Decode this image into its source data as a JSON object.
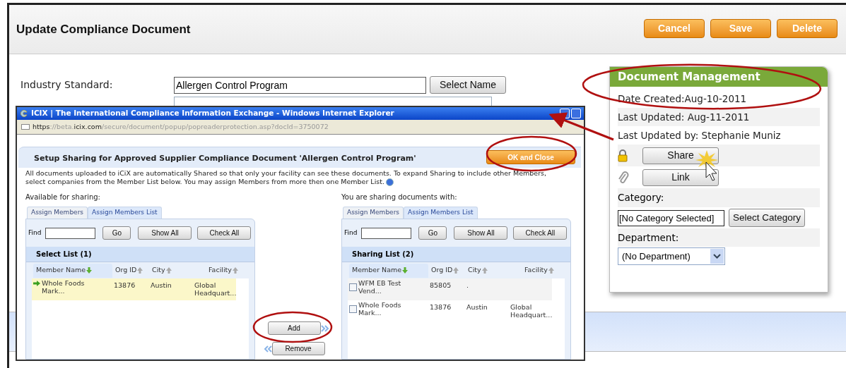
{
  "page": {
    "title": "Update Compliance Document",
    "buttons": [
      "Cancel",
      "Save",
      "Delete"
    ],
    "field": {
      "label": "Industry Standard:",
      "value": "Allergen Control Program",
      "button": "Select Name"
    }
  },
  "document_management": {
    "title": "Document Management",
    "info": [
      "Date Created:Aug-10-2011",
      "Last Updated: Aug-11-2011",
      "Last Updated by: Stephanie Muniz"
    ],
    "actions": [
      {
        "kind": "lock",
        "label": "Share"
      },
      {
        "kind": "clip",
        "label": "Link"
      }
    ],
    "category_label": "Category:",
    "category_value": "[No Category Selected]",
    "category_button": "Select Category",
    "department_label": "Department:",
    "department_value": "(No Department)"
  },
  "popup": {
    "window_title": "ICIX | The International Compliance Information Exchange - Windows Internet Explorer",
    "address": "**https**://beta.**icix.com**/secure/document/popup/popreaderprotection.asp?docId=3750072",
    "heading": "Setup Sharing for Approved Supplier Compliance Document 'Allergen Control Program'",
    "ok_button": "OK and Close",
    "description": "All documents uploaded to iCiX are automatically Shared so that only your facility can see these documents. To expand Sharing to include other Members, select companies from the Member List below. You may assign Members from more then one Member List.",
    "lists": [
      {
        "caption": "Available for sharing:",
        "tabs": [
          {
            "label": "Assign Members",
            "selected": false
          },
          {
            "label": "Assign Members List",
            "selected": true
          }
        ],
        "find_label": "Find",
        "buttons": [
          "Go",
          "Show All",
          "Check All"
        ],
        "title": "Select List (1)",
        "columns": [
          {
            "label": "Member Name",
            "sorted": true
          },
          {
            "label": "Org ID",
            "sorted": false
          },
          {
            "label": "City",
            "sorted": false
          },
          {
            "label": "Facility",
            "sorted": false
          }
        ],
        "rows": [
          {
            "kind": "arrow",
            "selected": true,
            "cells": [
              "Whole Foods Mark...",
              "13876",
              "Austin",
              "Global Headquart..."
            ]
          }
        ]
      },
      {
        "caption": "You are sharing documents with:",
        "tabs": [
          {
            "label": "Assign Members",
            "selected": false
          },
          {
            "label": "Assign Members List",
            "selected": true
          }
        ],
        "find_label": "Find",
        "buttons": [
          "Go",
          "Show All",
          "Check All"
        ],
        "title": "Sharing List (2)",
        "columns": [
          {
            "label": "Member Name",
            "sorted": true
          },
          {
            "label": "Org ID",
            "sorted": false
          },
          {
            "label": "City",
            "sorted": false
          },
          {
            "label": "Facility",
            "sorted": false
          }
        ],
        "rows": [
          {
            "kind": "checkbox",
            "checked": false,
            "cells": [
              "WFM EB Test Vend...",
              "85805",
              "."
            ]
          },
          {
            "kind": "checkbox",
            "checked": false,
            "cells": [
              "Whole Foods Mark...",
              "13876",
              "Austin",
              "Global Headquart..."
            ]
          }
        ]
      }
    ],
    "transfer_buttons": [
      "Add",
      "Remove"
    ]
  }
}
